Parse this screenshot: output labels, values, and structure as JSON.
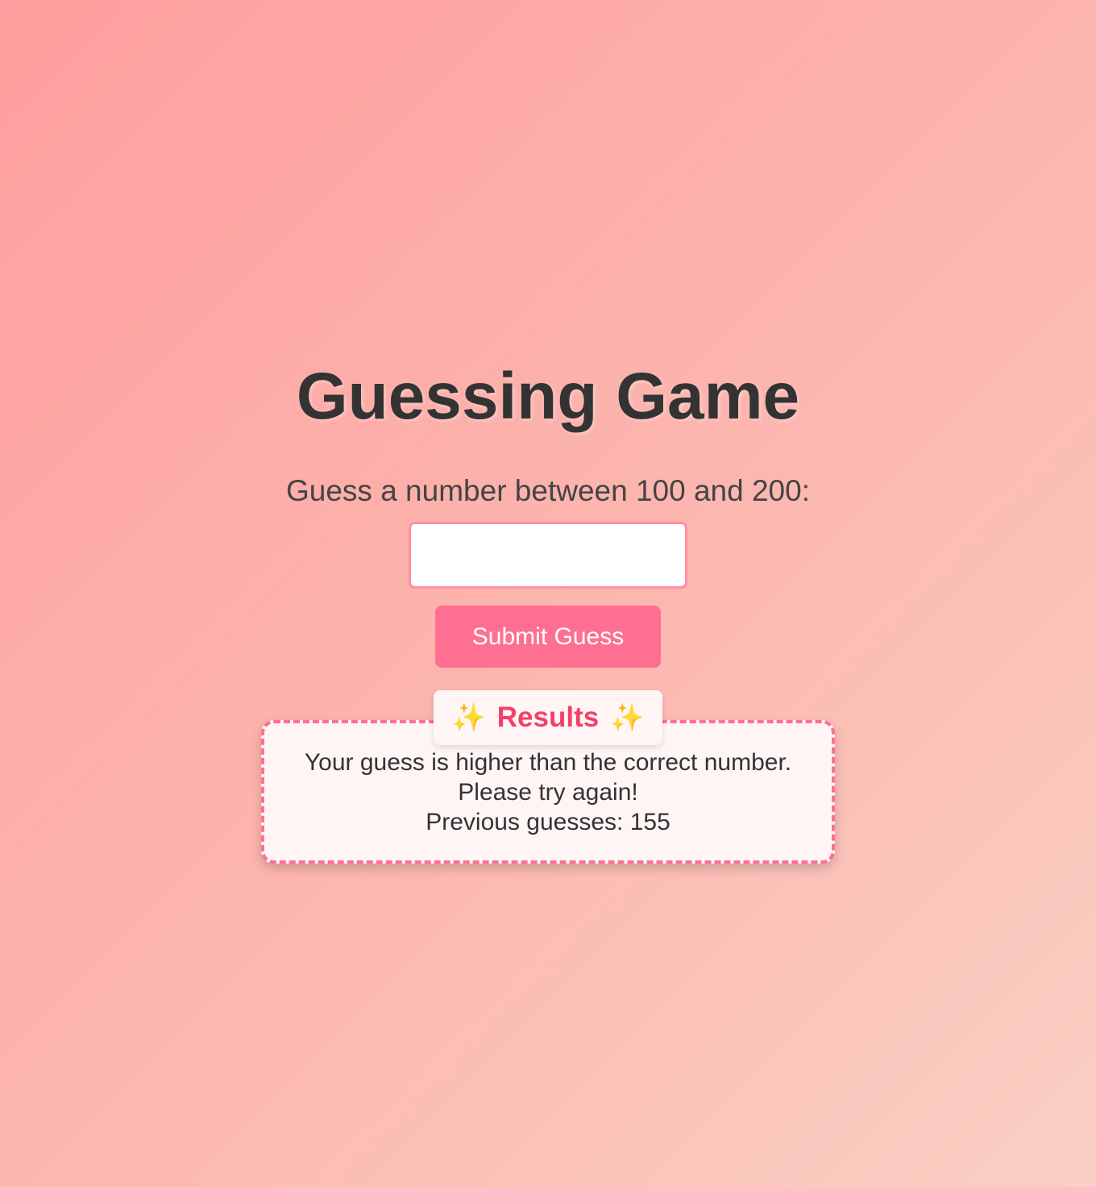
{
  "header": {
    "title": "Guessing Game"
  },
  "game": {
    "prompt": "Guess a number between 100 and 200:",
    "input_value": "",
    "input_placeholder": "",
    "submit_label": "Submit Guess"
  },
  "results": {
    "heading": "Results",
    "sparkle_left_icon": "sparkles-icon",
    "sparkle_right_icon": "sparkles-icon",
    "line1": "Your guess is higher than the correct number.",
    "line2": "Please try again!",
    "line3": "Previous guesses: 155"
  },
  "colors": {
    "accent": "#ff6f91",
    "heading_accent": "#f2406a",
    "sparkle": "#f5c33b",
    "text": "#333333"
  }
}
